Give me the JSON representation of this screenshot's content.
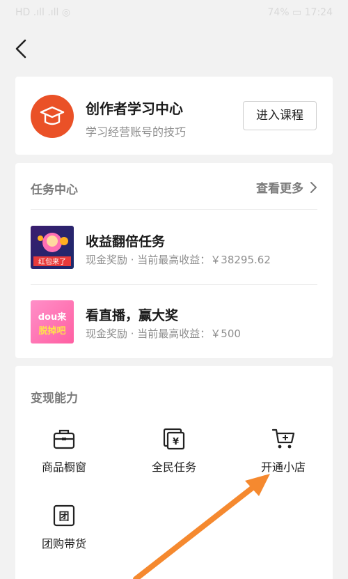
{
  "status_bar": {
    "left": "HD .ıll .ıll ◎",
    "right": "74% ▭ 17:24"
  },
  "creator_card": {
    "title": "创作者学习中心",
    "subtitle": "学习经营账号的技巧",
    "button_label": "进入课程"
  },
  "task_center": {
    "header": "任务中心",
    "see_more": "查看更多",
    "tasks": [
      {
        "title": "收益翻倍任务",
        "desc": "现金奖励 · 当前最高收益：￥38295.62",
        "thumb_text": "红包来了"
      },
      {
        "title": "看直播，赢大奖",
        "desc": "现金奖励 · 当前最高收益：￥500",
        "thumb_text": "dou来脱掉吧"
      }
    ]
  },
  "monetize": {
    "header": "变现能力",
    "items": [
      {
        "label": "商品橱窗",
        "icon": "showcase-bag-icon"
      },
      {
        "label": "全民任务",
        "icon": "yuan-task-icon"
      },
      {
        "label": "开通小店",
        "icon": "shopping-cart-icon"
      },
      {
        "label": "团购带货",
        "icon": "group-buy-icon"
      }
    ]
  },
  "colors": {
    "accent": "#ea5127",
    "arrow": "#f5892f",
    "background": "#f2f2f2"
  }
}
